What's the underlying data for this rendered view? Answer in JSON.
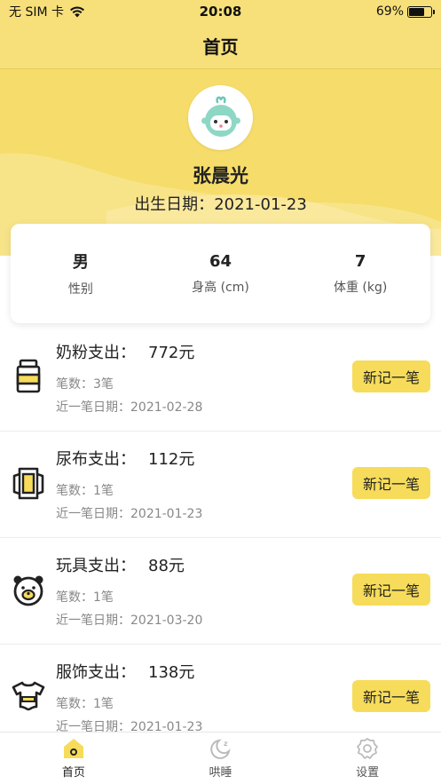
{
  "status_bar": {
    "carrier": "无 SIM 卡",
    "time": "20:08",
    "battery_text": "69%",
    "battery_level": 0.69
  },
  "nav": {
    "title": "首页"
  },
  "profile": {
    "name": "张晨光",
    "birth_label": "出生日期：",
    "birth_date": "2021-01-23",
    "stats": [
      {
        "value": "男",
        "label": "性别"
      },
      {
        "value": "64",
        "label": "身高 (cm)"
      },
      {
        "value": "7",
        "label": "体重 (kg)"
      }
    ]
  },
  "expenses": [
    {
      "icon": "milk-can-icon",
      "title": "奶粉支出：",
      "amount": "772元",
      "count_text": "笔数：3笔",
      "date_text": "近一笔日期：2021-02-28",
      "button": "新记一笔"
    },
    {
      "icon": "diaper-icon",
      "title": "尿布支出：",
      "amount": "112元",
      "count_text": "笔数：1笔",
      "date_text": "近一笔日期：2021-01-23",
      "button": "新记一笔"
    },
    {
      "icon": "bear-icon",
      "title": "玩具支出：",
      "amount": "88元",
      "count_text": "笔数：1笔",
      "date_text": "近一笔日期：2021-03-20",
      "button": "新记一笔"
    },
    {
      "icon": "onesie-icon",
      "title": "服饰支出：",
      "amount": "138元",
      "count_text": "笔数：1笔",
      "date_text": "近一笔日期：2021-01-23",
      "button": "新记一笔"
    }
  ],
  "tabs": [
    {
      "label": "首页",
      "icon": "home-icon",
      "active": true
    },
    {
      "label": "哄睡",
      "icon": "moon-icon",
      "active": false
    },
    {
      "label": "设置",
      "icon": "gear-icon",
      "active": false
    }
  ],
  "colors": {
    "brand_yellow": "#f6dc5a",
    "header_yellow": "#f7e07a",
    "icon_dark": "#222222"
  }
}
